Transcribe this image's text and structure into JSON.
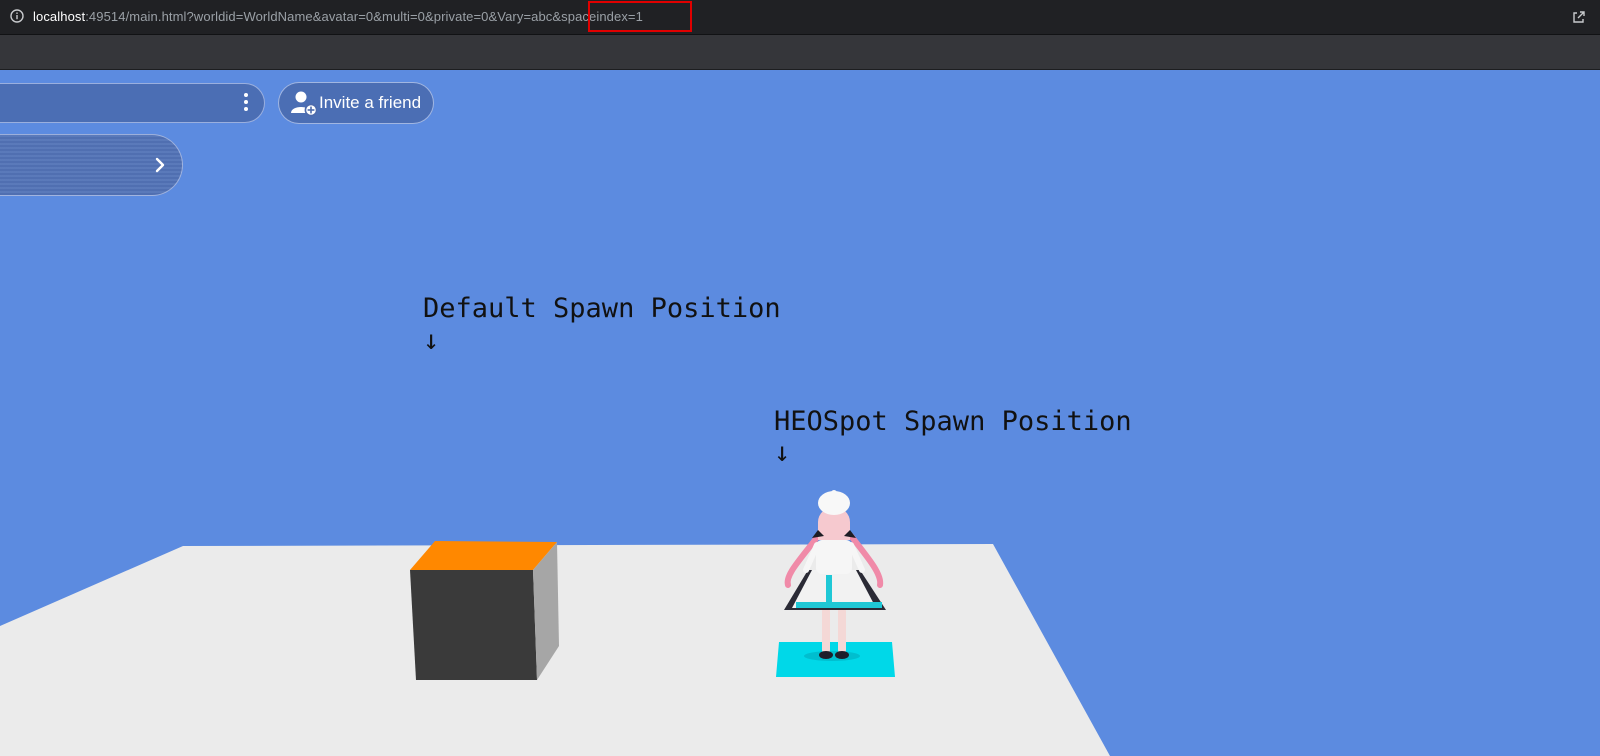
{
  "browser": {
    "url_host": "localhost",
    "url_rest": ":49514/main.html?worldid=WorldName&avatar=0&multi=0&private=0&Vary=abc&spaceindex=1",
    "highlighted_param": "&spaceindex=1"
  },
  "overlay": {
    "invite_label": "Invite a friend"
  },
  "scene": {
    "default_spawn_label": "Default Spawn Position",
    "heospot_spawn_label": "HEOSpot Spawn Position",
    "arrow": "↓",
    "colors": {
      "sky": "#5c8be0",
      "floor": "#ebebeb",
      "cube_front": "#3a3a3a",
      "cube_top": "#ff8800",
      "cube_side": "#a6a6a6",
      "spot": "#00d8e8"
    }
  }
}
